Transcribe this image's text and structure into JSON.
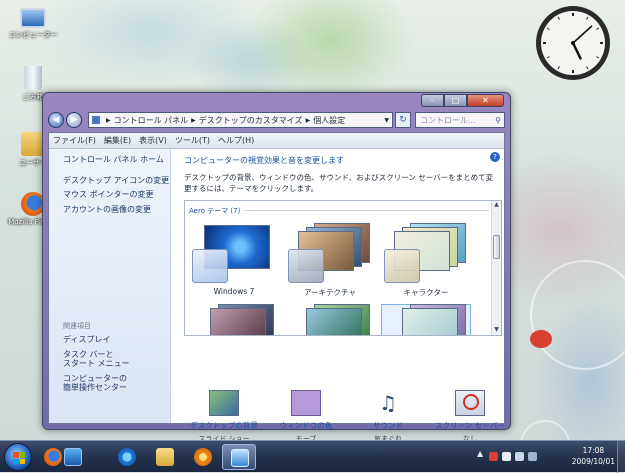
{
  "desktop": {
    "icons": [
      {
        "label": "コンピューター",
        "icon": "computer-icon"
      },
      {
        "label": "ごみ箱",
        "icon": "recycle-bin-icon"
      },
      {
        "label": "ユーザー",
        "icon": "user-folder-icon"
      },
      {
        "label": "Mozilla Firefox",
        "icon": "firefox-icon"
      }
    ]
  },
  "clock": {
    "hour": 5,
    "minute": 8
  },
  "window": {
    "caption_buttons": {
      "minimize": "–",
      "maximize": "□",
      "close": "✕"
    },
    "address": {
      "crumbs": [
        "コントロール パネル",
        "デスクトップのカスタマイズ",
        "個人設定"
      ],
      "search_placeholder": "コントロール..."
    },
    "menu": [
      "ファイル(F)",
      "編集(E)",
      "表示(V)",
      "ツール(T)",
      "ヘルプ(H)"
    ],
    "left": {
      "home": "コントロール パネル ホーム",
      "links": [
        "デスクトップ アイコンの変更",
        "マウス ポインターの変更",
        "アカウントの画像の変更"
      ],
      "see_also": "関連項目",
      "related": [
        "ディスプレイ",
        "タスク バーと",
        "スタート メニュー",
        "コンピューターの",
        "簡単操作センター"
      ]
    },
    "heading": "コンピューターの視覚効果と音を変更します",
    "description": "デスクトップの背景、ウィンドウの色、サウンド、およびスクリーン セーバーをまとめて変更するには、テーマをクリックします。",
    "theme_group": "Aero テーマ (7)",
    "themes": [
      {
        "name": "Windows 7"
      },
      {
        "name": "アーキテクチャ"
      },
      {
        "name": "キャラクター"
      }
    ],
    "settings": [
      {
        "title": "デスクトップの背景",
        "value": "スライド ショー",
        "icon": "desktop-background-icon"
      },
      {
        "title": "ウィンドウの色",
        "value": "モーブ",
        "icon": "window-color-icon",
        "color": "#b49ad8"
      },
      {
        "title": "サウンド",
        "value": "気まぐれ",
        "icon": "sound-icon"
      },
      {
        "title": "スクリーン セーバー",
        "value": "なし",
        "icon": "screen-saver-icon"
      }
    ]
  },
  "taskbar": {
    "time": "17:08",
    "date": "2009/10/01",
    "colors": {
      "accent": "#1e5fb8"
    }
  }
}
